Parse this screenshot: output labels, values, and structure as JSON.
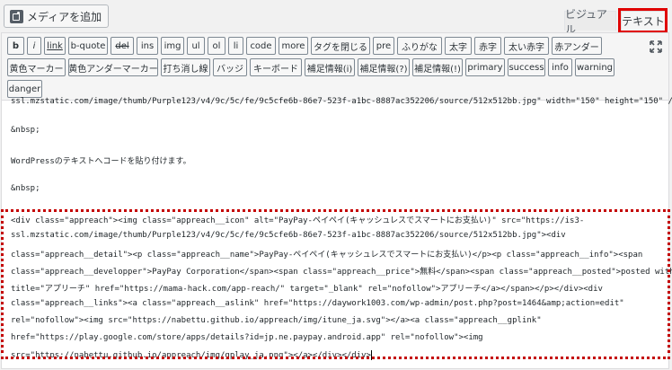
{
  "media_button": {
    "label": "メディアを追加",
    "icon": "media-add-icon"
  },
  "tabs": {
    "visual": "ビジュアル",
    "text": "テキスト"
  },
  "toolbar": {
    "row1": [
      "b",
      "i",
      "link",
      "b-quote",
      "del",
      "ins",
      "img",
      "ul",
      "ol",
      "li",
      "code",
      "more",
      "タグを閉じる",
      "pre",
      "ふりがな",
      "太字",
      "赤字",
      "太い赤字",
      "赤アンダー"
    ],
    "row2": [
      "黄色マーカー",
      "黄色アンダーマーカー",
      "打ち消し線",
      "バッジ",
      "キーボード",
      "補足情報(i)",
      "補足情報(?)",
      "補足情報(!)",
      "primary",
      "success",
      "info",
      "warning"
    ],
    "row3": [
      "danger"
    ],
    "fullscreen_icon": "fullscreen-icon"
  },
  "editor": {
    "partial_top": "ssl.mzstatic.com/image/thumb/Purple123/v4/9c/5c/fe/9c5cfe6b-86e7-523f-a1bc-8887ac352206/source/512x512bb.jpg\" width=\"150\" height=\"150\" />",
    "nbsp1": "&nbsp;",
    "plain_text": "WordPressのテキストへコードを貼り付けます。",
    "nbsp2": "&nbsp;",
    "code_lines": [
      "<div class=\"appreach\"><img class=\"appreach__icon\" alt=\"PayPay-ペイペイ(キャッシュレスでスマートにお支払い)\" src=\"https://is3-",
      "ssl.mzstatic.com/image/thumb/Purple123/v4/9c/5c/fe/9c5cfe6b-86e7-523f-a1bc-8887ac352206/source/512x512bb.jpg\"><div",
      "class=\"appreach__detail\"><p class=\"appreach__name\">PayPay-ペイペイ(キャッシュレスでスマートにお支払い)</p><p class=\"appreach__info\"><span",
      "class=\"appreach__developper\">PayPay Corporation</span><span class=\"appreach__price\">無料</span><span class=\"appreach__posted\">posted with<a",
      "title=\"アプリーチ\" href=\"https://mama-hack.com/app-reach/\" target=\"_blank\" rel=\"nofollow\">アプリーチ</a></span></p></div><div",
      "class=\"appreach__links\"><a class=\"appreach__aslink\" href=\"https://daywork1003.com/wp-admin/post.php?post=1464&amp;action=edit\"",
      "rel=\"nofollow\"><img src=\"https://nabettu.github.io/appreach/img/itune_ja.svg\"></a><a class=\"appreach__gplink\"",
      "href=\"https://play.google.com/store/apps/details?id=jp.ne.paypay.android.app\" rel=\"nofollow\"><img",
      "src=\"https://nabettu.github.io/appreach/img/gplay_ja.png\"></a></div></div>"
    ]
  },
  "colors": {
    "highlight": "#e00000",
    "dashed_border": "#c40000"
  }
}
